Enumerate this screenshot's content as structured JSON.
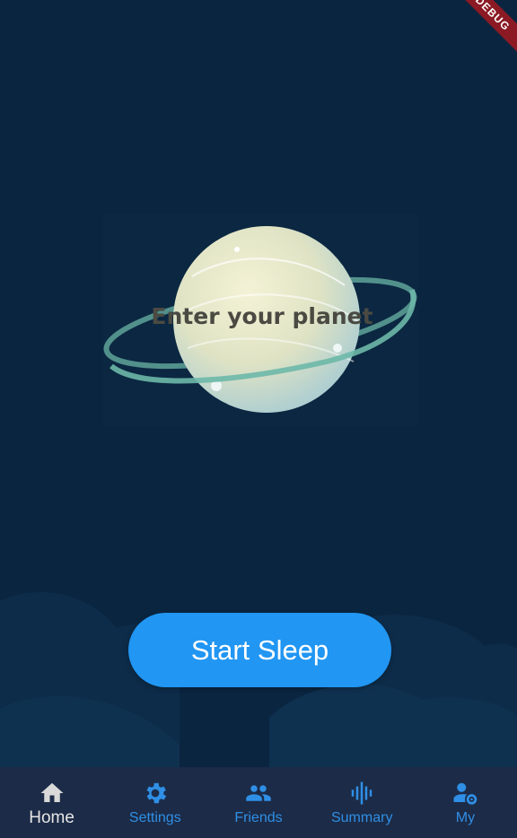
{
  "debug_banner": "DEBUG",
  "planet": {
    "label": "Enter your planet"
  },
  "actions": {
    "start_label": "Start Sleep"
  },
  "nav": {
    "items": [
      {
        "label": "Home",
        "icon": "home-icon",
        "active": true
      },
      {
        "label": "Settings",
        "icon": "gear-icon",
        "active": false
      },
      {
        "label": "Friends",
        "icon": "people-icon",
        "active": false
      },
      {
        "label": "Summary",
        "icon": "waveform-icon",
        "active": false
      },
      {
        "label": "My",
        "icon": "user-gear-icon",
        "active": false
      }
    ]
  },
  "colors": {
    "background": "#0a2540",
    "accent": "#2196f3",
    "nav_bg": "#1c2b47",
    "nav_inactive": "#2f8fe6",
    "nav_active": "#e6e6e6"
  }
}
